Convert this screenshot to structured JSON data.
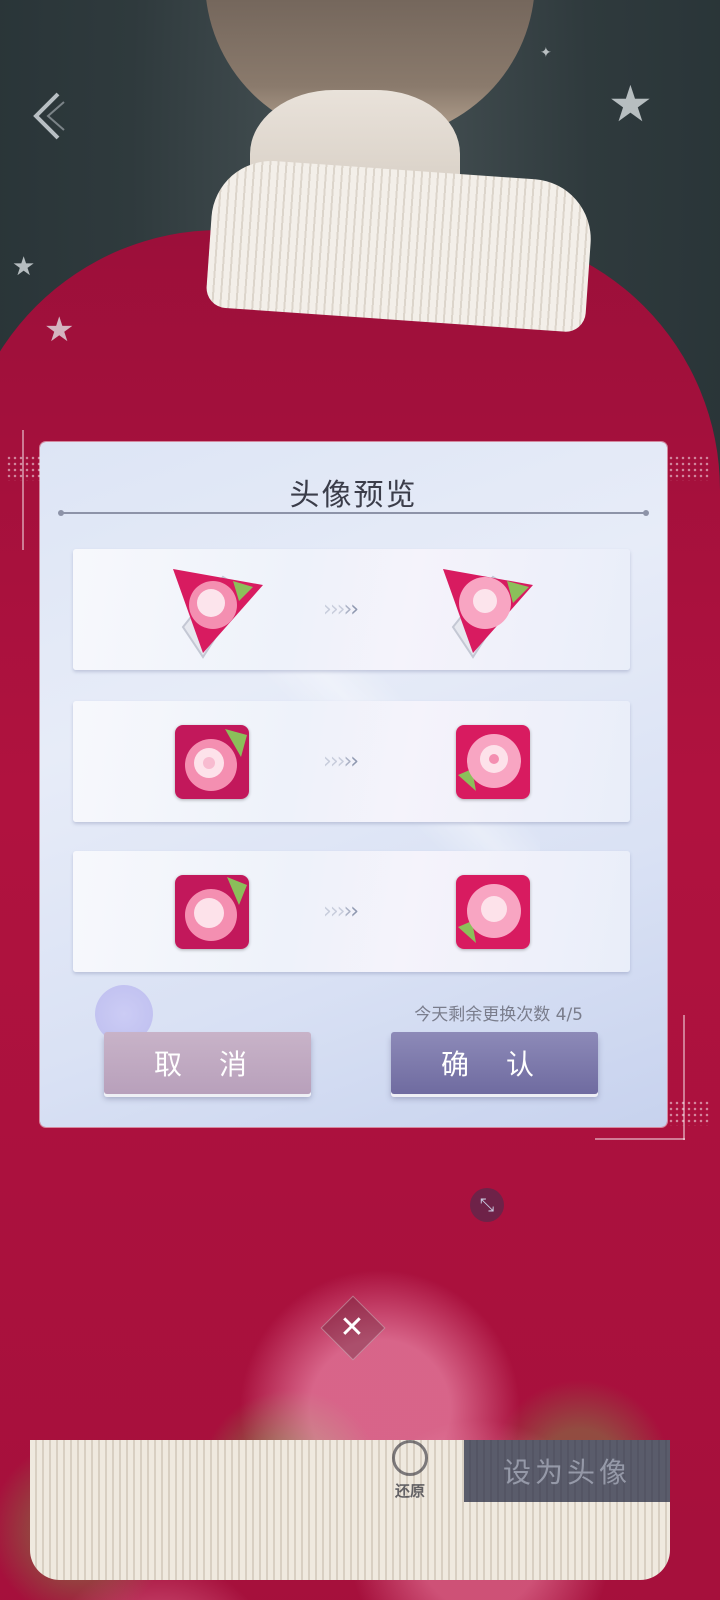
{
  "modal": {
    "title": "头像预览",
    "remaining_text": "今天剩余更换次数 4/5",
    "cancel_label": "取 消",
    "confirm_label": "确 认",
    "arrow_glyphs": [
      "›",
      "›",
      "›",
      "›",
      "›"
    ]
  },
  "bottom": {
    "close_glyph": "✕",
    "resize_glyph": "⤡",
    "restore_label": "还原",
    "set_avatar_label": "设为头像"
  },
  "colors": {
    "accent_confirm": "#6f6ba0",
    "accent_cancel": "#b8a0bb",
    "sweater_red": "#a5103c"
  }
}
